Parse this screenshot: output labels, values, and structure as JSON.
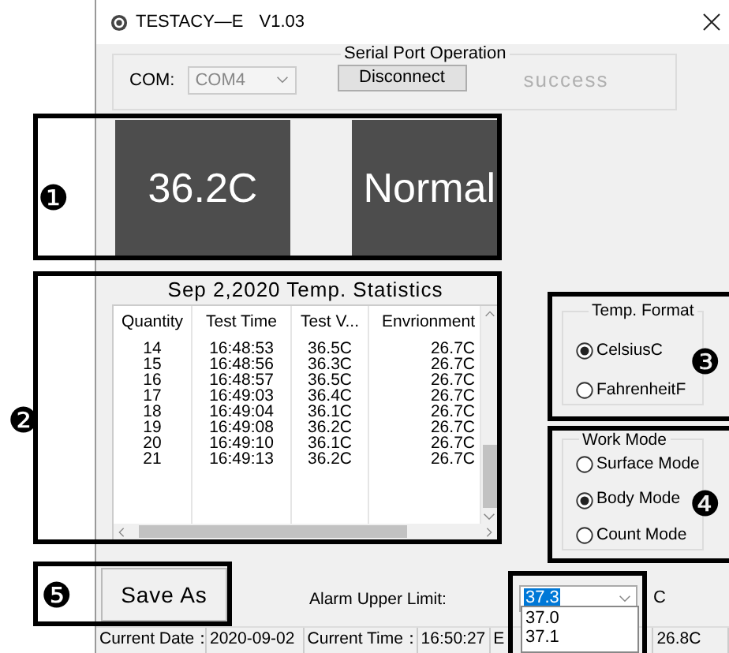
{
  "window": {
    "title": "TESTACY—E",
    "version": "V1.03"
  },
  "serial_port": {
    "title": "Serial Port Operation",
    "com_label": "COM:",
    "com_value": "COM4",
    "button": "Disconnect",
    "status": "success"
  },
  "readings": {
    "temperature": "36.2C",
    "result": "Normal"
  },
  "statistics": {
    "title": "Sep 2,2020 Temp. Statistics",
    "columns": [
      "Quantity",
      "Test Time",
      "Test V...",
      "Envrionment"
    ],
    "rows": [
      [
        "14",
        "16:48:53",
        "36.5C",
        "26.7C"
      ],
      [
        "15",
        "16:48:56",
        "36.3C",
        "26.7C"
      ],
      [
        "16",
        "16:48:57",
        "36.5C",
        "26.7C"
      ],
      [
        "17",
        "16:49:03",
        "36.4C",
        "26.7C"
      ],
      [
        "18",
        "16:49:04",
        "36.1C",
        "26.7C"
      ],
      [
        "19",
        "16:49:08",
        "36.2C",
        "26.7C"
      ],
      [
        "20",
        "16:49:10",
        "36.1C",
        "26.7C"
      ],
      [
        "21",
        "16:49:13",
        "36.2C",
        "26.7C"
      ]
    ]
  },
  "temp_format": {
    "title": "Temp. Format",
    "options": [
      {
        "label": "CelsiusC",
        "selected": true
      },
      {
        "label": "FahrenheitF",
        "selected": false
      }
    ]
  },
  "work_mode": {
    "title": "Work Mode",
    "options": [
      {
        "label": "Surface Mode",
        "selected": false
      },
      {
        "label": "Body Mode",
        "selected": true
      },
      {
        "label": "Count Mode",
        "selected": false
      }
    ]
  },
  "save_button": "Save As",
  "alarm": {
    "label": "Alarm Upper Limit:",
    "value": "37.3",
    "unit": "C",
    "options": [
      "37.0",
      "37.1"
    ]
  },
  "status_bar": [
    "Current Date：",
    "2020-09-02",
    "Current Time：",
    "16:50:27",
    "E",
    "26.8C"
  ],
  "annotations": [
    "❶",
    "❷",
    "❸",
    "❹",
    "❺"
  ]
}
